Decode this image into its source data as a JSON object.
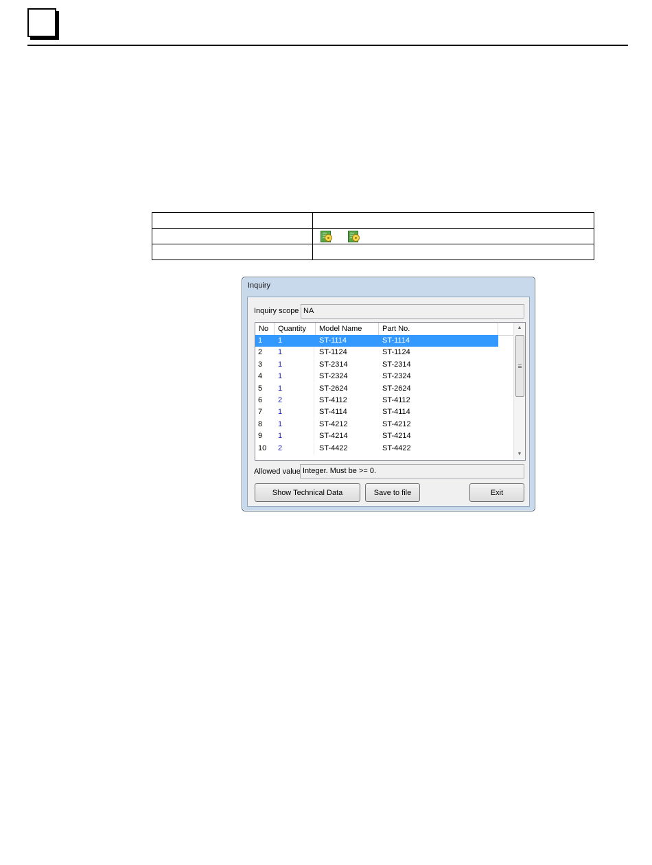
{
  "dialog": {
    "title": "Inquiry",
    "scope_label": "Inquiry scope",
    "scope_value": "NA",
    "columns": [
      "No",
      "Quantity",
      "Model Name",
      "Part No."
    ],
    "rows": [
      {
        "no": "1",
        "qty": "1",
        "model": "ST-1114",
        "part": "ST-1114",
        "selected": true
      },
      {
        "no": "2",
        "qty": "1",
        "model": "ST-1124",
        "part": "ST-1124"
      },
      {
        "no": "3",
        "qty": "1",
        "model": "ST-2314",
        "part": "ST-2314"
      },
      {
        "no": "4",
        "qty": "1",
        "model": "ST-2324",
        "part": "ST-2324"
      },
      {
        "no": "5",
        "qty": "1",
        "model": "ST-2624",
        "part": "ST-2624"
      },
      {
        "no": "6",
        "qty": "2",
        "model": "ST-4112",
        "part": "ST-4112"
      },
      {
        "no": "7",
        "qty": "1",
        "model": "ST-4114",
        "part": "ST-4114"
      },
      {
        "no": "8",
        "qty": "1",
        "model": "ST-4212",
        "part": "ST-4212"
      },
      {
        "no": "9",
        "qty": "1",
        "model": "ST-4214",
        "part": "ST-4214"
      },
      {
        "no": "10",
        "qty": "2",
        "model": "ST-4422",
        "part": "ST-4422"
      }
    ],
    "allowed_label": "Allowed value",
    "allowed_value": "Integer. Must be >= 0.",
    "buttons": {
      "technical": "Show Technical Data",
      "save": "Save to file",
      "exit": "Exit"
    }
  },
  "table_icons": [
    "document-gear-icon",
    "document-gear-icon"
  ],
  "colors": {
    "selection": "#3399ff",
    "quantity_text": "#1b1bb5"
  }
}
